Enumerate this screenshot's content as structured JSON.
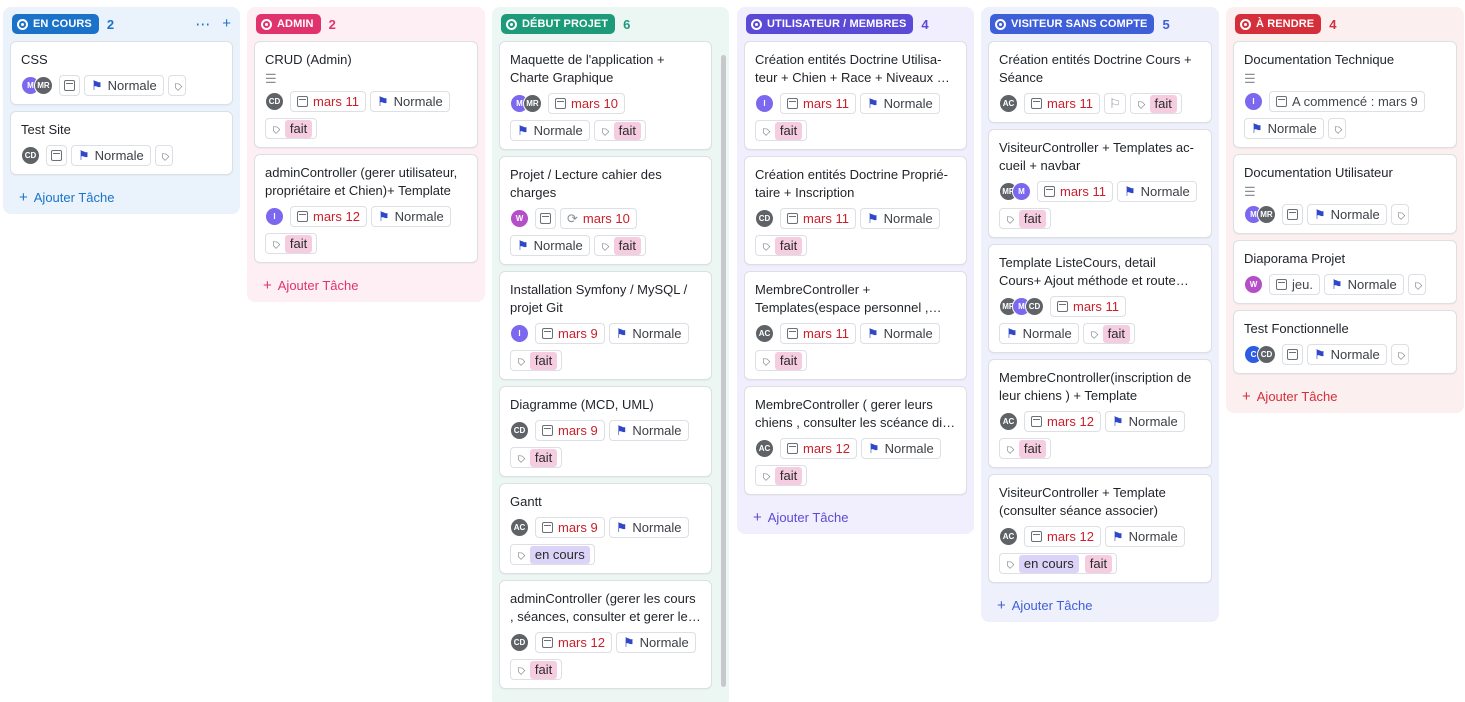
{
  "colors": {
    "encours": "#1a73c8",
    "admin": "#e0336e",
    "debut": "#1c9a7a",
    "utilisateur": "#5b4ad6",
    "visiteur": "#3f5fd9",
    "arendre": "#d42f3b",
    "tag_fait": "#f6cde0",
    "tag_encours": "#dcd3f8",
    "date_overdue": "#c9202c"
  },
  "icons": [
    "status-dot-icon",
    "more-icon",
    "plus-icon",
    "description-icon",
    "calendar-icon",
    "flag-icon",
    "tag-icon",
    "recurring-icon",
    "guest-icon"
  ],
  "columns": [
    {
      "name": "EN COURS",
      "count": "2",
      "add": "Ajouter Tâche",
      "more": "⋯",
      "plus": "+",
      "cards": [
        {
          "title": "CSS",
          "avatars": [
            "M",
            "MR"
          ],
          "priority": "Normale"
        },
        {
          "title": "Test Site",
          "avatars": [
            "CD"
          ],
          "priority": "Normale"
        }
      ]
    },
    {
      "name": "ADMIN",
      "count": "2",
      "add": "Ajouter Tâche",
      "cards": [
        {
          "title": "CRUD (Admin)",
          "avatars": [
            "CD"
          ],
          "date": "mars 11",
          "priority": "Normale",
          "tags": [
            "fait"
          ]
        },
        {
          "title": "adminController (gerer utilisateur, propriétaire et Chien)+ Template",
          "avatars": [
            "I"
          ],
          "date": "mars 12",
          "priority": "Normale",
          "tags": [
            "fait"
          ]
        }
      ]
    },
    {
      "name": "DÉBUT PROJET",
      "count": "6",
      "add": "Ajouter Tâche",
      "cards": [
        {
          "title": "Maquette de l'application + Charte Graphique",
          "avatars": [
            "M",
            "MR"
          ],
          "date": "mars 10",
          "priority": "Normale",
          "tags": [
            "fait"
          ]
        },
        {
          "title": "Projet / Lecture cahier des charges",
          "avatars": [
            "W"
          ],
          "date": "mars 10",
          "priority": "Normale",
          "tags": [
            "fait"
          ]
        },
        {
          "title": "Installation Symfony / MySQL / projet Git",
          "avatars": [
            "I"
          ],
          "date": "mars 9",
          "priority": "Normale",
          "tags": [
            "fait"
          ]
        },
        {
          "title": "Diagramme (MCD, UML)",
          "avatars": [
            "CD"
          ],
          "date": "mars 9",
          "priority": "Normale",
          "tags": [
            "fait"
          ]
        },
        {
          "title": "Gantt",
          "avatars": [
            "AC"
          ],
          "date": "mars 9",
          "priority": "Normale",
          "tags": [
            "en cours"
          ]
        },
        {
          "title": "adminController (gerer les cours , séances, consulter et gerer les chiens)",
          "avatars": [
            "CD"
          ],
          "date": "mars 12",
          "priority": "Normale",
          "tags": [
            "fait"
          ]
        }
      ]
    },
    {
      "name": "UTILISATEUR / MEMBRES",
      "count": "4",
      "add": "Ajouter Tâche",
      "cards": [
        {
          "title": "Création entités Doctrine Utilisa­teur + Chien + Race + Niveaux + Propriétaire",
          "avatars": [
            "I"
          ],
          "date": "mars 11",
          "priority": "Normale",
          "tags": [
            "fait"
          ]
        },
        {
          "title": "Création entités Doctrine Proprié­taire + Inscription",
          "avatars": [
            "CD"
          ],
          "date": "mars 11",
          "priority": "Normale",
          "tags": [
            "fait"
          ]
        },
        {
          "title": "MembreController + Templates(espace personnel , informations)",
          "avatars": [
            "AC"
          ],
          "date": "mars 11",
          "priority": "Normale",
          "tags": [
            "fait"
          ]
        },
        {
          "title": "MembreController ( gerer leurs chiens , consulter les scéance dis­ponibles)",
          "avatars": [
            "AC"
          ],
          "date": "mars 12",
          "priority": "Normale",
          "tags": [
            "fait"
          ]
        }
      ]
    },
    {
      "name": "VISITEUR SANS COMPTE",
      "count": "5",
      "add": "Ajouter Tâche",
      "cards": [
        {
          "title": "Création entités Doctrine Cours + Séance",
          "avatars": [
            "AC"
          ],
          "date": "mars 11",
          "tags": [
            "fait"
          ]
        },
        {
          "title": "VisiteurController + Templates ac­cueil + navbar",
          "avatars": [
            "MR",
            "M"
          ],
          "date": "mars 11",
          "priority": "Normale",
          "tags": [
            "fait"
          ]
        },
        {
          "title": "Template ListeCours, detail Cours+ Ajout méthode et route dans VisiteurController",
          "avatars": [
            "MR",
            "M",
            "CD"
          ],
          "date": "mars 11",
          "priority": "Normale",
          "tags": [
            "fait"
          ]
        },
        {
          "title": "MembreCnontroller(inscription de leur chiens ) + Template",
          "avatars": [
            "AC"
          ],
          "date": "mars 12",
          "priority": "Normale",
          "tags": [
            "fait"
          ]
        },
        {
          "title": "VisiteurController + Template (consulter séance associer)",
          "avatars": [
            "AC"
          ],
          "date": "mars 12",
          "priority": "Normale",
          "tags": [
            "en cours",
            "fait"
          ]
        }
      ]
    },
    {
      "name": "À RENDRE",
      "count": "4",
      "add": "Ajouter Tâche",
      "cards": [
        {
          "title": "Documentation Technique",
          "avatars": [
            "I"
          ],
          "date": "A commencé : mars 9",
          "priority": "Normale"
        },
        {
          "title": "Documentation Utilisateur",
          "avatars": [
            "M",
            "MR"
          ],
          "priority": "Normale"
        },
        {
          "title": "Diaporama Projet",
          "avatars": [
            "W"
          ],
          "date": "jeu.",
          "priority": "Normale"
        },
        {
          "title": "Test Fonctionnelle",
          "avatars": [
            "C",
            "CD"
          ],
          "priority": "Normale"
        }
      ]
    }
  ]
}
